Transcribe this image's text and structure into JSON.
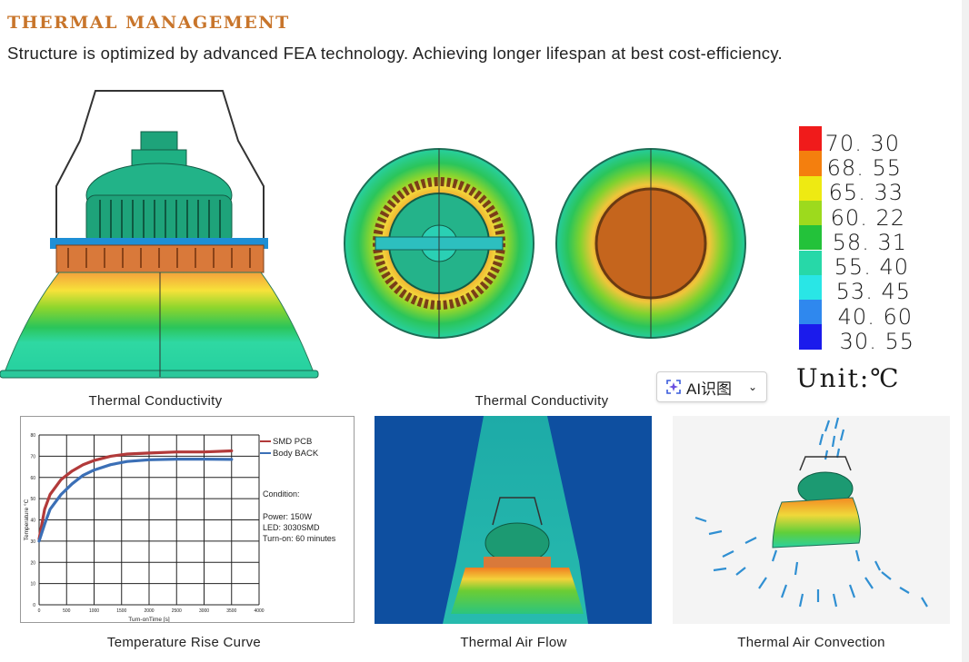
{
  "header": {
    "title": "THERMAL MANAGEMENT",
    "subtitle": "Structure is optimized by advanced FEA  technology. Achieving longer lifespan at best cost-efficiency."
  },
  "legend": {
    "values": [
      "70. 30",
      "68. 55",
      "65. 33",
      "60. 22",
      "58. 31",
      "55. 40",
      "53. 45",
      "40. 60",
      "30. 55"
    ],
    "colors": [
      "#f01b1b",
      "#f47f0e",
      "#eeea12",
      "#9dda1d",
      "#23c23a",
      "#27d8a8",
      "#29e6e6",
      "#2f88ee",
      "#1b1bec"
    ],
    "unit": "Unit:℃"
  },
  "ai_button": {
    "label": "AI识图",
    "icon": "ai-sparkle-icon",
    "chevron": "⌄"
  },
  "captions": {
    "side_view": "Thermal Conductivity",
    "top_views": "Thermal Conductivity",
    "rise_curve": "Temperature Rise Curve",
    "air_flow": "Thermal Air Flow",
    "air_convection": "Thermal Air Convection"
  },
  "chart_conditions": {
    "condition": "Condition:",
    "power": "Power: 150W",
    "led": "LED: 3030SMD",
    "turn_on": "Turn-on: 60 minutes"
  },
  "chart_data": {
    "type": "line",
    "title": "",
    "xlabel": "Turn-onTime [s]",
    "ylabel": "Temperature °C",
    "xlim": [
      0,
      4000
    ],
    "ylim": [
      0,
      80
    ],
    "x_ticks": [
      "0",
      "500",
      "1000",
      "1500",
      "2000",
      "2500",
      "3000",
      "3500",
      "4000"
    ],
    "y_ticks": [
      "0",
      "10",
      "20",
      "30",
      "40",
      "50",
      "60",
      "70",
      "80"
    ],
    "grid": true,
    "legend_position": "top-right",
    "series": [
      {
        "name": "SMD PCB",
        "color": "#b23a3a",
        "x": [
          0,
          100,
          200,
          400,
          600,
          800,
          1000,
          1300,
          1600,
          2000,
          2500,
          3000,
          3500
        ],
        "y": [
          31,
          45,
          52,
          59,
          63,
          66,
          68,
          70,
          71,
          71.5,
          72,
          72,
          72.5
        ]
      },
      {
        "name": "Body BACK",
        "color": "#3b6fb6",
        "x": [
          0,
          100,
          200,
          400,
          600,
          800,
          1000,
          1300,
          1600,
          2000,
          2500,
          3000,
          3500
        ],
        "y": [
          30,
          38,
          45,
          52,
          57,
          61,
          63.5,
          66,
          67.5,
          68.3,
          68.6,
          68.6,
          68.5
        ]
      }
    ]
  }
}
